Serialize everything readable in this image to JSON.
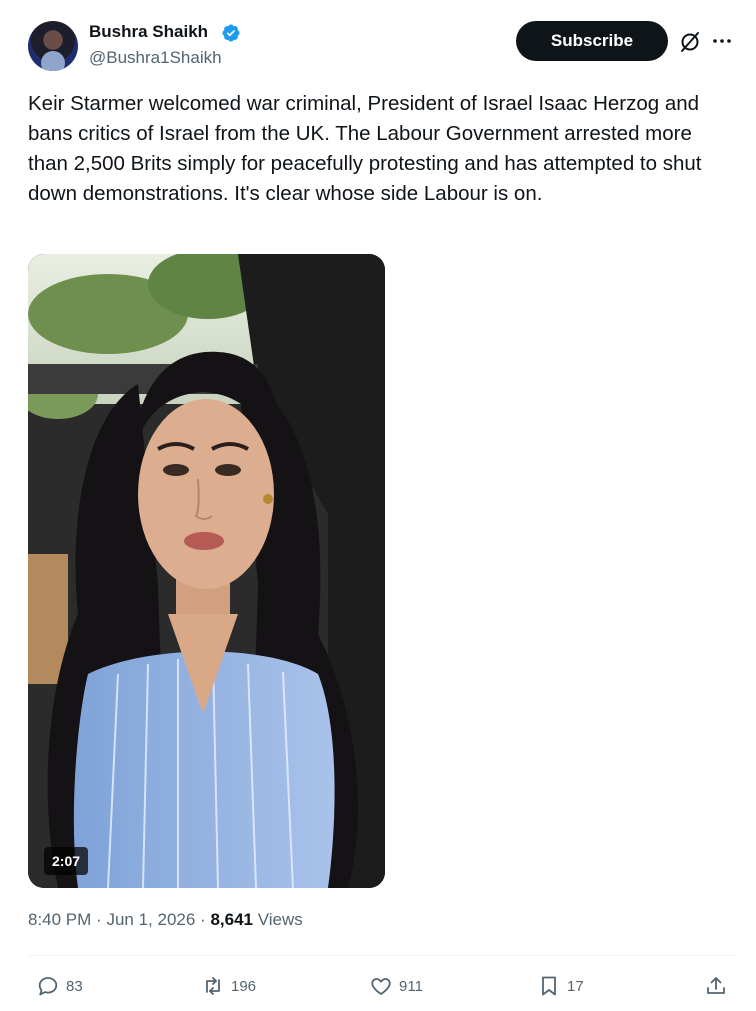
{
  "author": {
    "display_name": "Bushra Shaikh",
    "handle": "@Bushra1Shaikh",
    "verified": true,
    "verified_color": "#1d9bf0"
  },
  "header": {
    "subscribe_label": "Subscribe",
    "grok_icon": "grok-icon",
    "more_icon": "more-icon"
  },
  "tweet": {
    "text": "Keir Starmer welcomed war criminal, President of Israel Isaac Herzog and bans critics of Israel from the UK. The Labour Government arrested more than 2,500 Brits simply for peacefully protesting and has attempted to shut down demonstrations. It's clear whose side Labour is on."
  },
  "media": {
    "type": "video",
    "duration": "2:07"
  },
  "meta": {
    "time": "8:40 PM",
    "separator": "·",
    "date": "Jun 1, 2026",
    "views_count": "8,641",
    "views_label": "Views"
  },
  "actions": {
    "replies": "83",
    "reposts": "196",
    "likes": "911",
    "bookmarks": "17"
  },
  "colors": {
    "text": "#0f1419",
    "secondary": "#536471",
    "divider": "#eff3f4"
  }
}
